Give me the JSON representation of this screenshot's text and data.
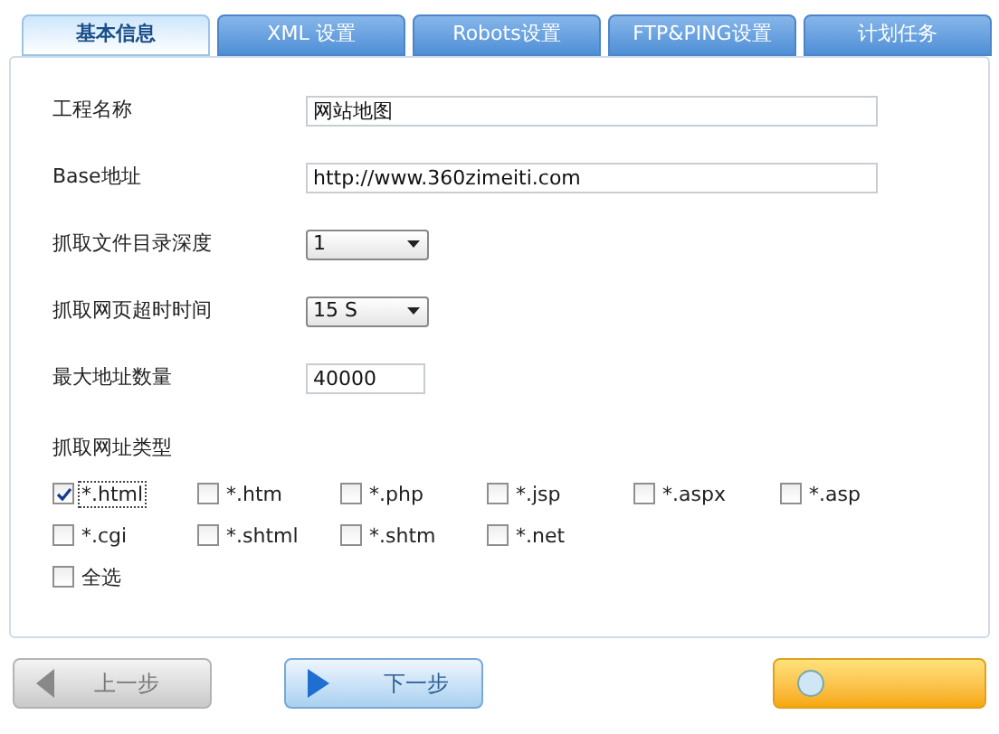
{
  "tabs": [
    {
      "label": "基本信息",
      "selected": true
    },
    {
      "label": "XML 设置",
      "selected": false
    },
    {
      "label": "Robots设置",
      "selected": false
    },
    {
      "label": "FTP&PING设置",
      "selected": false
    },
    {
      "label": "计划任务",
      "selected": false
    }
  ],
  "fields": [
    {
      "kind": "text",
      "label": "工程名称",
      "value": "网站地图"
    },
    {
      "kind": "text",
      "label": "Base地址",
      "value": "http://www.360zimeiti.com"
    },
    {
      "kind": "select",
      "label": "抓取文件目录深度",
      "value": "1"
    },
    {
      "kind": "select",
      "label": "抓取网页超时时间",
      "value": "15 S"
    },
    {
      "kind": "number",
      "label": "最大地址数量",
      "value": "40000"
    }
  ],
  "url_types": {
    "label": "抓取网址类型",
    "options": [
      {
        "label": "*.html",
        "checked": true,
        "focused": true
      },
      {
        "label": "*.htm",
        "checked": false,
        "focused": false
      },
      {
        "label": "*.php",
        "checked": false,
        "focused": false
      },
      {
        "label": "*.jsp",
        "checked": false,
        "focused": false
      },
      {
        "label": "*.aspx",
        "checked": false,
        "focused": false
      },
      {
        "label": "*.asp",
        "checked": false,
        "focused": false
      },
      {
        "label": "*.cgi",
        "checked": false,
        "focused": false
      },
      {
        "label": "*.shtml",
        "checked": false,
        "focused": false
      },
      {
        "label": "*.shtm",
        "checked": false,
        "focused": false
      },
      {
        "label": "*.net",
        "checked": false,
        "focused": false
      }
    ],
    "select_all": {
      "label": "全选",
      "checked": false
    }
  },
  "buttons": [
    {
      "kind": "back",
      "label": "上一步",
      "disabled": true
    },
    {
      "kind": "next",
      "label": "下一步",
      "disabled": false
    },
    {
      "kind": "finish",
      "disabled": false
    }
  ]
}
